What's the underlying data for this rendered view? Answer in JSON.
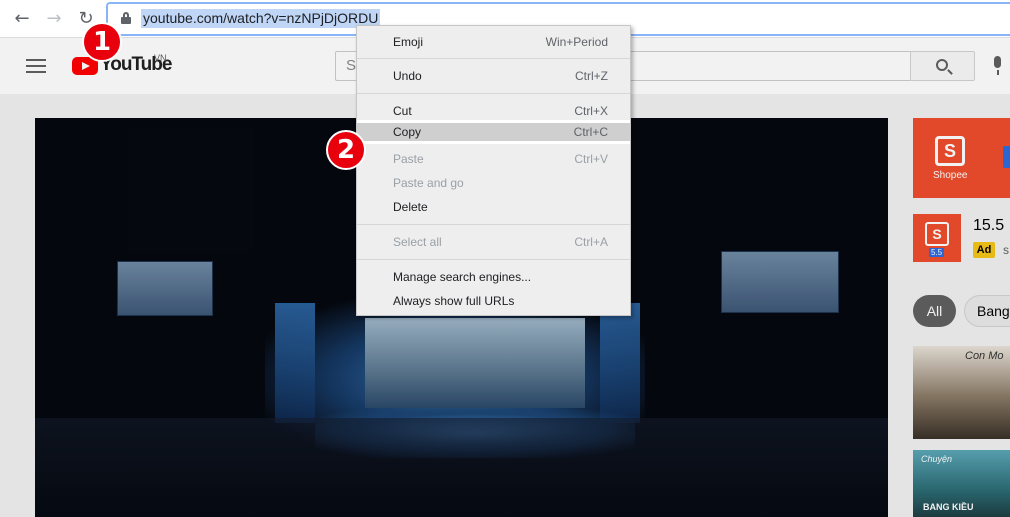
{
  "browser": {
    "back_icon": "arrow-left-icon",
    "forward_icon": "arrow-right-icon",
    "reload_icon": "reload-icon",
    "url": "youtube.com/watch?v=nzNPjDjORDU"
  },
  "youtube": {
    "logo_text": "YouTube",
    "region": "VN",
    "search_placeholder": "S"
  },
  "context_menu": {
    "items": [
      {
        "label": "Emoji",
        "shortcut": "Win+Period",
        "enabled": true
      },
      {
        "label": "Undo",
        "shortcut": "Ctrl+Z",
        "enabled": true
      },
      {
        "label": "Cut",
        "shortcut": "Ctrl+X",
        "enabled": true
      },
      {
        "label": "Copy",
        "shortcut": "Ctrl+C",
        "enabled": true,
        "highlighted": true
      },
      {
        "label": "Paste",
        "shortcut": "Ctrl+V",
        "enabled": false
      },
      {
        "label": "Paste and go",
        "shortcut": "",
        "enabled": false
      },
      {
        "label": "Delete",
        "shortcut": "",
        "enabled": true
      },
      {
        "label": "Select all",
        "shortcut": "Ctrl+A",
        "enabled": false
      },
      {
        "label": "Manage search engines...",
        "shortcut": "",
        "enabled": true
      },
      {
        "label": "Always show full URLs",
        "shortcut": "",
        "enabled": true
      }
    ]
  },
  "sidebar": {
    "ad_banner_label": "Shopee",
    "ad_title": "15.5",
    "ad_badge": "Ad",
    "ad_channel": "s",
    "ad_thumb_number": "5.5",
    "chips": [
      "All",
      "Bang"
    ],
    "rec_1_text": "Con Mo",
    "rec_2_top_text": "Chuyện",
    "rec_2_bottom_text": "BANG KIỀU"
  },
  "annotations": {
    "step_1": "1",
    "step_2": "2"
  },
  "colors": {
    "accent_red": "#e8000d",
    "url_selection": "#bfd6f6",
    "shopee_orange": "#ee4d2d"
  }
}
